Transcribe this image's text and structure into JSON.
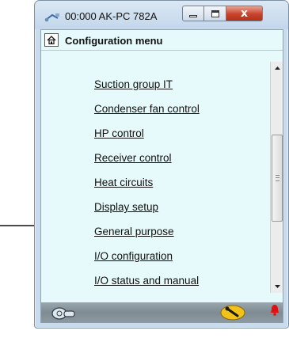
{
  "window": {
    "title": "00:000 AK-PC 782A",
    "close_symbol": "x"
  },
  "header": {
    "title": "Configuration menu"
  },
  "menu": {
    "items": [
      {
        "label": "Suction group IT"
      },
      {
        "label": "Condenser fan control"
      },
      {
        "label": "HP control"
      },
      {
        "label": "Receiver control"
      },
      {
        "label": "Heat circuits"
      },
      {
        "label": "Display setup"
      },
      {
        "label": "General purpose"
      },
      {
        "label": "I/O configuration"
      },
      {
        "label": "I/O status and manual"
      }
    ]
  },
  "colors": {
    "client_background": "#e7fafb",
    "close_button": "#c8432c",
    "tool_icon": "#f2c21a",
    "alarm_icon": "#e01010"
  },
  "icons": {
    "app": "probe-icon",
    "home": "home-icon",
    "footer_left": "controller-icon",
    "footer_tool": "wrench-icon",
    "footer_alarm": "alarm-bell-icon",
    "annotation": "pointer-arrow"
  }
}
